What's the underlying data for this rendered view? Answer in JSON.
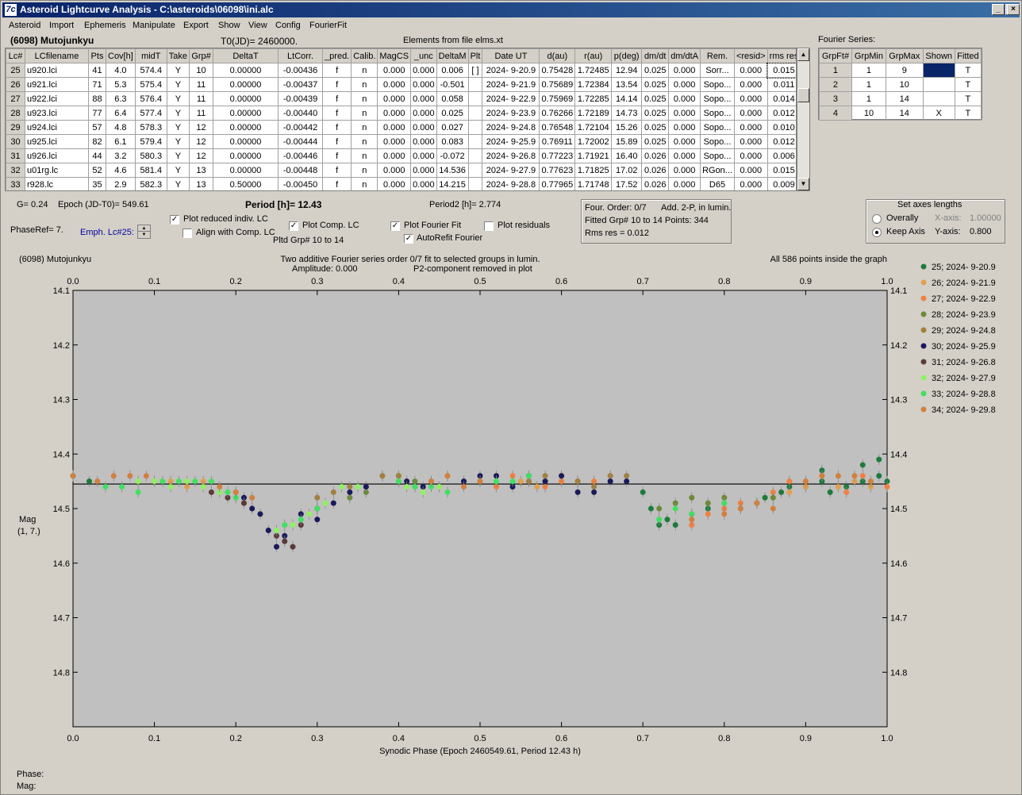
{
  "window": {
    "title": "Asteroid Lightcurve Analysis - C:\\asteroids\\06098\\ini.alc",
    "icon": "7c",
    "buttons": [
      "minimize-icon",
      "maximize-icon",
      "close-icon"
    ]
  },
  "menu": [
    "Asteroid",
    "Import",
    "Ephemeris",
    "Manipulate",
    "Export",
    "Show",
    "View",
    "Config",
    "FourierFit"
  ],
  "header": {
    "asteroid": "(6098) Mutojunkyu",
    "t0": "T0(JD)= 2460000.",
    "elements": "Elements from file elms.xt"
  },
  "lc_table": {
    "columns": [
      "Lc#",
      "LCfilename",
      "Pts",
      "Cov[h]",
      "midT",
      "Take",
      "Grp#",
      "DeltaT",
      "LtCorr.",
      "_pred.",
      "Calib.",
      "MagCS",
      "_unc",
      "DeltaM",
      "Plt",
      "Date UT",
      "d(au)",
      "r(au)",
      "p(deg)",
      "dm/dt",
      "dm/dtA",
      "Rem.",
      "<resid>",
      "rms res"
    ],
    "rows": [
      [
        "25",
        "u920.lci",
        "41",
        "4.0",
        "574.4",
        "Y",
        "10",
        "0.00000",
        "-0.00436",
        "f",
        "n",
        "0.000",
        "0.000",
        "0.006",
        "[ ]",
        "2024- 9-20.9",
        "0.75428",
        "1.72485",
        "12.94",
        "0.025",
        "0.000",
        "Sorr...",
        "0.000",
        "0.015"
      ],
      [
        "26",
        "u921.lci",
        "71",
        "5.3",
        "575.4",
        "Y",
        "11",
        "0.00000",
        "-0.00437",
        "f",
        "n",
        "0.000",
        "0.000",
        "-0.501",
        "",
        "2024- 9-21.9",
        "0.75689",
        "1.72384",
        "13.54",
        "0.025",
        "0.000",
        "Sopo...",
        "0.000",
        "0.011"
      ],
      [
        "27",
        "u922.lci",
        "88",
        "6.3",
        "576.4",
        "Y",
        "11",
        "0.00000",
        "-0.00439",
        "f",
        "n",
        "0.000",
        "0.000",
        "0.058",
        "",
        "2024- 9-22.9",
        "0.75969",
        "1.72285",
        "14.14",
        "0.025",
        "0.000",
        "Sopo...",
        "0.000",
        "0.014"
      ],
      [
        "28",
        "u923.lci",
        "77",
        "6.4",
        "577.4",
        "Y",
        "11",
        "0.00000",
        "-0.00440",
        "f",
        "n",
        "0.000",
        "0.000",
        "0.025",
        "",
        "2024- 9-23.9",
        "0.76266",
        "1.72189",
        "14.73",
        "0.025",
        "0.000",
        "Sopo...",
        "0.000",
        "0.012"
      ],
      [
        "29",
        "u924.lci",
        "57",
        "4.8",
        "578.3",
        "Y",
        "12",
        "0.00000",
        "-0.00442",
        "f",
        "n",
        "0.000",
        "0.000",
        "0.027",
        "",
        "2024- 9-24.8",
        "0.76548",
        "1.72104",
        "15.26",
        "0.025",
        "0.000",
        "Sopo...",
        "0.000",
        "0.010"
      ],
      [
        "30",
        "u925.lci",
        "82",
        "6.1",
        "579.4",
        "Y",
        "12",
        "0.00000",
        "-0.00444",
        "f",
        "n",
        "0.000",
        "0.000",
        "0.083",
        "",
        "2024- 9-25.9",
        "0.76911",
        "1.72002",
        "15.89",
        "0.025",
        "0.000",
        "Sopo...",
        "0.000",
        "0.012"
      ],
      [
        "31",
        "u926.lci",
        "44",
        "3.2",
        "580.3",
        "Y",
        "12",
        "0.00000",
        "-0.00446",
        "f",
        "n",
        "0.000",
        "0.000",
        "-0.072",
        "",
        "2024- 9-26.8",
        "0.77223",
        "1.71921",
        "16.40",
        "0.026",
        "0.000",
        "Sopo...",
        "0.000",
        "0.006"
      ],
      [
        "32",
        "u01rg.lc",
        "52",
        "4.6",
        "581.4",
        "Y",
        "13",
        "0.00000",
        "-0.00448",
        "f",
        "n",
        "0.000",
        "0.000",
        "14.536",
        "",
        "2024- 9-27.9",
        "0.77623",
        "1.71825",
        "17.02",
        "0.026",
        "0.000",
        "RGon...",
        "0.000",
        "0.015"
      ],
      [
        "33",
        "r928.lc",
        "35",
        "2.9",
        "582.3",
        "Y",
        "13",
        "0.50000",
        "-0.00450",
        "f",
        "n",
        "0.000",
        "0.000",
        "14.215",
        "",
        "2024- 9-28.8",
        "0.77965",
        "1.71748",
        "17.52",
        "0.026",
        "0.000",
        "D65",
        "0.000",
        "0.009"
      ]
    ]
  },
  "fourier_series": {
    "title": "Fourier Series:",
    "columns": [
      "GrpFt#",
      "GrpMin",
      "GrpMax",
      "Shown",
      "Fitted"
    ],
    "rows": [
      [
        "1",
        "1",
        "9",
        "",
        "T"
      ],
      [
        "2",
        "1",
        "10",
        "",
        "T"
      ],
      [
        "3",
        "1",
        "14",
        "",
        "T"
      ],
      [
        "4",
        "10",
        "14",
        "X",
        "T"
      ]
    ]
  },
  "controls": {
    "g": "G= 0.24",
    "epoch": "Epoch (JD-T0)= 549.61",
    "period": "Period [h]= 12.43",
    "period2": "Period2 [h]= 2.774",
    "phaseref": "PhaseRef= 7.",
    "emph": "Emph. Lc#25:",
    "plot_reduced": "Plot reduced indiv. LC",
    "align": "Align with Comp. LC",
    "plot_comp": "Plot Comp. LC",
    "pltd_grp": "Pltd Grp#  10 to   14",
    "plot_fourier": "Plot Fourier Fit",
    "autorefit": "AutoRefit Fourier",
    "plot_resid": "Plot residuals",
    "four_order": "Four. Order:  0/7",
    "add2p": "Add. 2-P, in lumin.",
    "fitted": "Fitted Grp# 10 to 14 Points: 344",
    "rms": "Rms res     = 0.012",
    "axes_title": "Set axes lengths",
    "overally": "Overally",
    "keep_axis": "Keep Axis",
    "xaxis_label": "X-axis:",
    "xaxis_val": "1.00000",
    "yaxis_label": "Y-axis:",
    "yaxis_val": "0.800"
  },
  "plot": {
    "top_left": "(6098) Mutojunkyu",
    "subtitle1": "Two additive Fourier series order 0/7 fit to selected groups in lumin.",
    "subtitle2": "Amplitude: 0.000",
    "subtitle3": "P2-component removed in plot",
    "top_right": "All 586 points inside the graph",
    "ylabel1": "Mag",
    "ylabel2": "(1, 7.)",
    "xlabel": "Synodic Phase (Epoch 2460549.61, Period 12.43 h)"
  },
  "chart_data": {
    "type": "scatter",
    "x": [
      0,
      1
    ],
    "ylim": [
      14.1,
      14.9
    ],
    "y_inverted": true,
    "xticks": [
      "0.0",
      "0.1",
      "0.2",
      "0.3",
      "0.4",
      "0.5",
      "0.6",
      "0.7",
      "0.8",
      "0.9",
      "1.0"
    ],
    "yticks": [
      "14.1",
      "14.2",
      "14.3",
      "14.4",
      "14.5",
      "14.6",
      "14.7",
      "14.8"
    ],
    "fit_line": 14.455,
    "series": [
      {
        "name": "25; 2024- 9-20.9",
        "color": "#1e7a3c",
        "points": [
          [
            0.7,
            14.47
          ],
          [
            0.71,
            14.5
          ],
          [
            0.72,
            14.53
          ],
          [
            0.73,
            14.52
          ],
          [
            0.74,
            14.53
          ],
          [
            0.76,
            14.51
          ],
          [
            0.78,
            14.5
          ],
          [
            0.85,
            14.48
          ],
          [
            0.87,
            14.47
          ],
          [
            0.9,
            14.46
          ],
          [
            0.92,
            14.45
          ],
          [
            0.95,
            14.46
          ],
          [
            0.97,
            14.45
          ],
          [
            0.99,
            14.44
          ],
          [
            1.0,
            14.45
          ],
          [
            0.0,
            14.44
          ],
          [
            0.02,
            14.45
          ],
          [
            0.92,
            14.43
          ],
          [
            0.97,
            14.42
          ],
          [
            0.99,
            14.41
          ],
          [
            0.88,
            14.46
          ],
          [
            0.93,
            14.47
          ]
        ]
      },
      {
        "name": "26; 2024- 9-21.9",
        "color": "#e0a050",
        "points": [
          [
            0.1,
            14.45
          ],
          [
            0.12,
            14.45
          ],
          [
            0.14,
            14.46
          ],
          [
            0.16,
            14.45
          ],
          [
            0.38,
            14.44
          ],
          [
            0.4,
            14.45
          ],
          [
            0.42,
            14.46
          ],
          [
            0.45,
            14.46
          ],
          [
            0.48,
            14.45
          ],
          [
            0.55,
            14.45
          ],
          [
            0.57,
            14.46
          ],
          [
            0.6,
            14.45
          ],
          [
            0.62,
            14.45
          ],
          [
            0.64,
            14.46
          ],
          [
            0.88,
            14.47
          ],
          [
            0.9,
            14.46
          ],
          [
            0.94,
            14.46
          ],
          [
            0.96,
            14.45
          ],
          [
            0.98,
            14.46
          ]
        ]
      },
      {
        "name": "27; 2024- 9-22.9",
        "color": "#f08040",
        "points": [
          [
            0.2,
            14.47
          ],
          [
            0.21,
            14.49
          ],
          [
            0.22,
            14.5
          ],
          [
            0.44,
            14.45
          ],
          [
            0.46,
            14.44
          ],
          [
            0.5,
            14.45
          ],
          [
            0.52,
            14.46
          ],
          [
            0.54,
            14.44
          ],
          [
            0.56,
            14.45
          ],
          [
            0.58,
            14.46
          ],
          [
            0.6,
            14.45
          ],
          [
            0.62,
            14.45
          ],
          [
            0.64,
            14.45
          ],
          [
            0.66,
            14.44
          ],
          [
            0.76,
            14.53
          ],
          [
            0.78,
            14.51
          ],
          [
            0.8,
            14.5
          ],
          [
            0.82,
            14.49
          ],
          [
            0.84,
            14.49
          ],
          [
            0.86,
            14.47
          ],
          [
            0.88,
            14.45
          ],
          [
            0.9,
            14.45
          ],
          [
            0.92,
            14.44
          ],
          [
            0.95,
            14.47
          ],
          [
            0.97,
            14.44
          ],
          [
            1.0,
            14.46
          ]
        ]
      },
      {
        "name": "28; 2024- 9-23.9",
        "color": "#6b8a3a",
        "points": [
          [
            0.72,
            14.5
          ],
          [
            0.74,
            14.49
          ],
          [
            0.76,
            14.48
          ],
          [
            0.78,
            14.49
          ],
          [
            0.8,
            14.48
          ],
          [
            0.82,
            14.5
          ],
          [
            0.84,
            14.49
          ],
          [
            0.86,
            14.48
          ],
          [
            0.4,
            14.44
          ],
          [
            0.42,
            14.45
          ],
          [
            0.36,
            14.47
          ],
          [
            0.34,
            14.48
          ]
        ]
      },
      {
        "name": "29; 2024- 9-24.8",
        "color": "#a08040",
        "points": [
          [
            0.3,
            14.48
          ],
          [
            0.32,
            14.47
          ],
          [
            0.34,
            14.46
          ],
          [
            0.36,
            14.46
          ],
          [
            0.38,
            14.44
          ],
          [
            0.4,
            14.44
          ],
          [
            0.56,
            14.45
          ],
          [
            0.58,
            14.44
          ],
          [
            0.6,
            14.44
          ],
          [
            0.62,
            14.45
          ],
          [
            0.64,
            14.46
          ],
          [
            0.66,
            14.44
          ],
          [
            0.68,
            14.44
          ]
        ]
      },
      {
        "name": "30; 2024- 9-25.9",
        "color": "#1a1a5a",
        "points": [
          [
            0.21,
            14.48
          ],
          [
            0.22,
            14.5
          ],
          [
            0.23,
            14.51
          ],
          [
            0.24,
            14.54
          ],
          [
            0.25,
            14.57
          ],
          [
            0.26,
            14.55
          ],
          [
            0.28,
            14.51
          ],
          [
            0.3,
            14.52
          ],
          [
            0.32,
            14.49
          ],
          [
            0.34,
            14.47
          ],
          [
            0.36,
            14.46
          ],
          [
            0.41,
            14.45
          ],
          [
            0.43,
            14.46
          ],
          [
            0.48,
            14.45
          ],
          [
            0.5,
            14.44
          ],
          [
            0.52,
            14.44
          ],
          [
            0.54,
            14.46
          ],
          [
            0.56,
            14.44
          ],
          [
            0.58,
            14.45
          ],
          [
            0.6,
            14.44
          ],
          [
            0.62,
            14.47
          ],
          [
            0.64,
            14.47
          ],
          [
            0.66,
            14.45
          ],
          [
            0.68,
            14.45
          ]
        ]
      },
      {
        "name": "31; 2024- 9-26.8",
        "color": "#5a3a3a",
        "points": [
          [
            0.17,
            14.47
          ],
          [
            0.19,
            14.48
          ],
          [
            0.21,
            14.49
          ],
          [
            0.25,
            14.55
          ],
          [
            0.26,
            14.56
          ],
          [
            0.27,
            14.57
          ],
          [
            0.28,
            14.53
          ],
          [
            0.3,
            14.5
          ]
        ]
      },
      {
        "name": "32; 2024- 9-27.9",
        "color": "#90f060",
        "points": [
          [
            0.08,
            14.45
          ],
          [
            0.1,
            14.45
          ],
          [
            0.12,
            14.46
          ],
          [
            0.14,
            14.45
          ],
          [
            0.16,
            14.46
          ],
          [
            0.18,
            14.47
          ],
          [
            0.2,
            14.48
          ],
          [
            0.25,
            14.54
          ],
          [
            0.27,
            14.53
          ],
          [
            0.29,
            14.51
          ],
          [
            0.31,
            14.49
          ],
          [
            0.33,
            14.46
          ],
          [
            0.35,
            14.46
          ],
          [
            0.41,
            14.46
          ],
          [
            0.43,
            14.47
          ],
          [
            0.45,
            14.46
          ],
          [
            0.5,
            14.45
          ],
          [
            0.52,
            14.45
          ]
        ]
      },
      {
        "name": "33; 2024- 9-28.8",
        "color": "#40e060",
        "points": [
          [
            0.04,
            14.46
          ],
          [
            0.06,
            14.46
          ],
          [
            0.08,
            14.47
          ],
          [
            0.11,
            14.45
          ],
          [
            0.13,
            14.45
          ],
          [
            0.15,
            14.45
          ],
          [
            0.17,
            14.45
          ],
          [
            0.19,
            14.47
          ],
          [
            0.2,
            14.48
          ],
          [
            0.26,
            14.53
          ],
          [
            0.28,
            14.52
          ],
          [
            0.3,
            14.5
          ],
          [
            0.4,
            14.45
          ],
          [
            0.42,
            14.46
          ],
          [
            0.44,
            14.46
          ],
          [
            0.46,
            14.47
          ],
          [
            0.52,
            14.45
          ],
          [
            0.54,
            14.45
          ],
          [
            0.56,
            14.44
          ],
          [
            0.72,
            14.52
          ],
          [
            0.74,
            14.5
          ],
          [
            0.76,
            14.51
          ],
          [
            0.8,
            14.49
          ]
        ]
      },
      {
        "name": "34; 2024- 9-29.8",
        "color": "#d08040",
        "points": [
          [
            0.0,
            14.44
          ],
          [
            0.03,
            14.45
          ],
          [
            0.05,
            14.44
          ],
          [
            0.07,
            14.44
          ],
          [
            0.09,
            14.44
          ],
          [
            0.18,
            14.46
          ],
          [
            0.2,
            14.47
          ],
          [
            0.22,
            14.48
          ],
          [
            0.44,
            14.45
          ],
          [
            0.46,
            14.44
          ],
          [
            0.48,
            14.46
          ],
          [
            0.5,
            14.45
          ],
          [
            0.76,
            14.52
          ],
          [
            0.8,
            14.51
          ],
          [
            0.82,
            14.5
          ],
          [
            0.84,
            14.49
          ],
          [
            0.86,
            14.5
          ],
          [
            0.9,
            14.45
          ],
          [
            0.92,
            14.44
          ],
          [
            0.94,
            14.44
          ],
          [
            0.96,
            14.44
          ],
          [
            0.98,
            14.45
          ]
        ]
      }
    ]
  }
}
